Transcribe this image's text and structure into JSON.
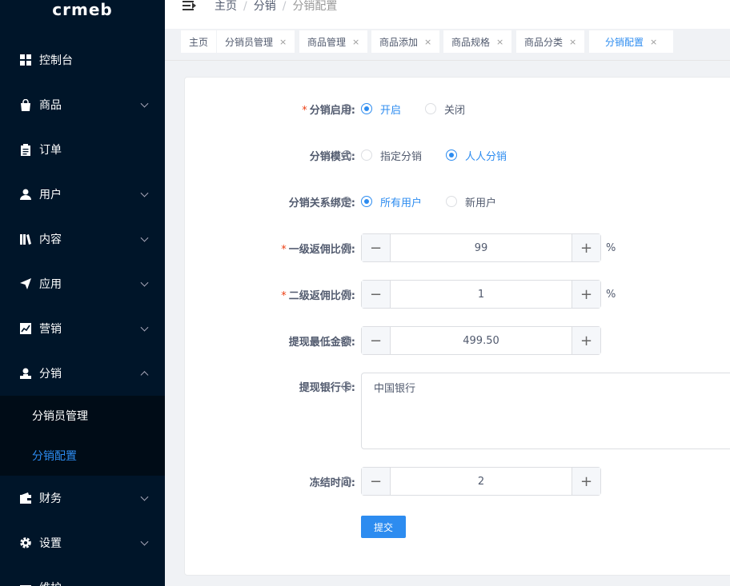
{
  "app": {
    "logo": "crmeb"
  },
  "sidebar": {
    "items": [
      {
        "label": "控制台",
        "icon": "dashboard-icon",
        "has_children": false
      },
      {
        "label": "商品",
        "icon": "shopping-bag-icon",
        "has_children": true
      },
      {
        "label": "订单",
        "icon": "clipboard-icon",
        "has_children": false
      },
      {
        "label": "用户",
        "icon": "user-icon",
        "has_children": true
      },
      {
        "label": "内容",
        "icon": "book-icon",
        "has_children": true
      },
      {
        "label": "应用",
        "icon": "send-icon",
        "has_children": true
      },
      {
        "label": "营销",
        "icon": "chart-icon",
        "has_children": true
      },
      {
        "label": "分销",
        "icon": "person-icon",
        "has_children": true,
        "expanded": true
      },
      {
        "label": "财务",
        "icon": "wallet-icon",
        "has_children": true
      },
      {
        "label": "设置",
        "icon": "gear-icon",
        "has_children": true
      },
      {
        "label": "维护",
        "icon": "tool-icon",
        "has_children": true
      }
    ],
    "submenu": [
      {
        "label": "分销员管理",
        "active": false
      },
      {
        "label": "分销配置",
        "active": true
      }
    ]
  },
  "breadcrumb": [
    "主页",
    "分销",
    "分销配置"
  ],
  "tabs": [
    {
      "label": "主页",
      "closable": false
    },
    {
      "label": "分销员管理",
      "closable": true
    },
    {
      "label": "商品管理",
      "closable": true
    },
    {
      "label": "商品添加",
      "closable": true
    },
    {
      "label": "商品规格",
      "closable": true
    },
    {
      "label": "商品分类",
      "closable": true
    },
    {
      "label": "分销配置",
      "closable": true,
      "active": true
    }
  ],
  "tab_close_glyph": "×",
  "form": {
    "enable": {
      "label": "分销启用:",
      "required": true,
      "options": [
        "开启",
        "关闭"
      ],
      "selected": "开启"
    },
    "mode": {
      "label": "分销模式:",
      "required": false,
      "options": [
        "指定分销",
        "人人分销"
      ],
      "selected": "人人分销"
    },
    "binding": {
      "label": "分销关系绑定:",
      "required": false,
      "options": [
        "所有用户",
        "新用户"
      ],
      "selected": "所有用户"
    },
    "level1": {
      "label": "一级返佣比例:",
      "required": true,
      "value": "99",
      "unit": "%"
    },
    "level2": {
      "label": "二级返佣比例:",
      "required": true,
      "value": "1",
      "unit": "%"
    },
    "min_withdraw": {
      "label": "提现最低金额:",
      "required": false,
      "value": "499.50"
    },
    "bank": {
      "label": "提现银行卡:",
      "required": false,
      "value": "中国银行"
    },
    "freeze": {
      "label": "冻结时间:",
      "required": false,
      "value": "2"
    },
    "submit_label": "提交",
    "required_mark": "*",
    "info_glyph": "!",
    "minus_glyph": "−",
    "plus_glyph": "+"
  },
  "colors": {
    "primary": "#2d8cf0",
    "sidebar_bg": "#001529",
    "required": "#ed4014"
  }
}
